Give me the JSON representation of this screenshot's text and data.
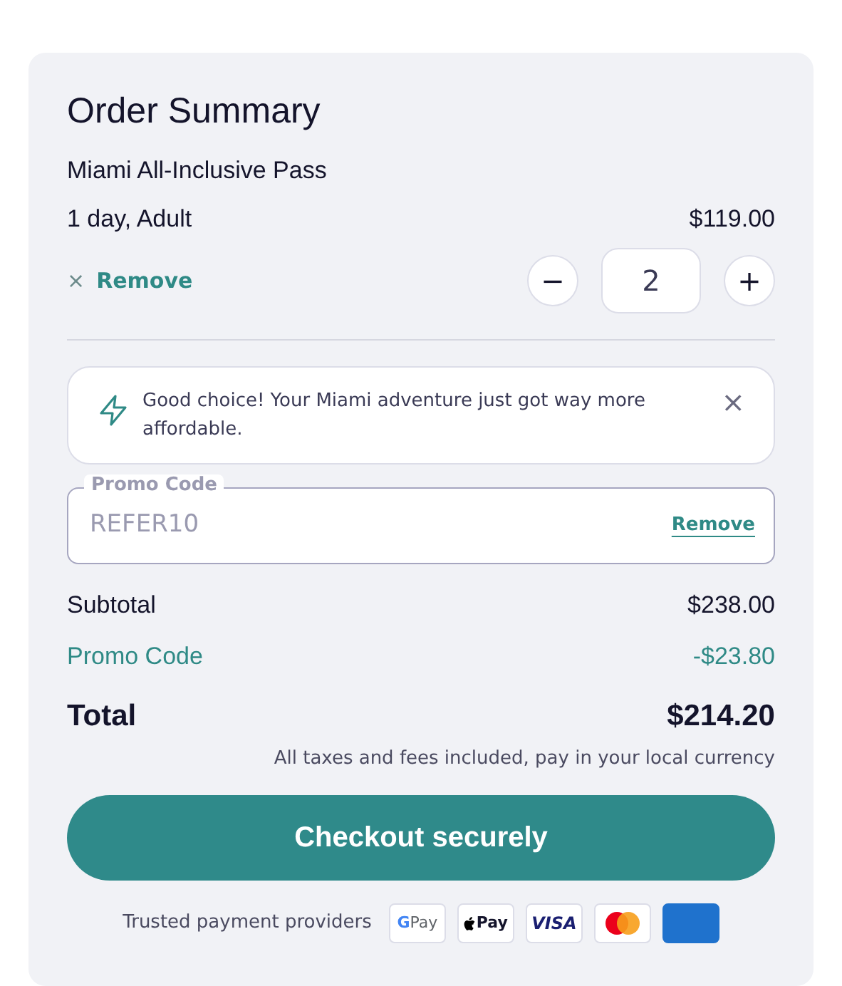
{
  "title": "Order Summary",
  "product": {
    "name": "Miami All-Inclusive Pass",
    "variant": "1 day, Adult",
    "price": "$119.00"
  },
  "remove": {
    "icon": "×",
    "label": "Remove"
  },
  "quantity": {
    "decrement": "−",
    "value": "2",
    "increment": "+"
  },
  "notice": {
    "text": "Good choice! Your Miami adventure just got way more affordable.",
    "close": "×"
  },
  "promo": {
    "label": "Promo Code",
    "value": "REFER10",
    "disabled": true,
    "action": "Remove"
  },
  "totals": [
    {
      "kind": "plain",
      "label": "Subtotal",
      "value": "$238.00"
    },
    {
      "kind": "discount",
      "label": "Promo Code",
      "value": "-$23.80"
    },
    {
      "kind": "total",
      "label": "Total",
      "value": "$214.20"
    }
  ],
  "tax_note": "All taxes and fees included, pay in your local currency",
  "checkout_button": "Checkout securely",
  "payments": {
    "label": "Trusted payment providers",
    "methods": [
      {
        "kind": "gpay",
        "mark": "G",
        "text": "Pay"
      },
      {
        "kind": "applepay",
        "text": "Pay"
      },
      {
        "kind": "visa",
        "text": "VISA"
      },
      {
        "kind": "mastercard"
      },
      {
        "kind": "amex"
      }
    ]
  }
}
